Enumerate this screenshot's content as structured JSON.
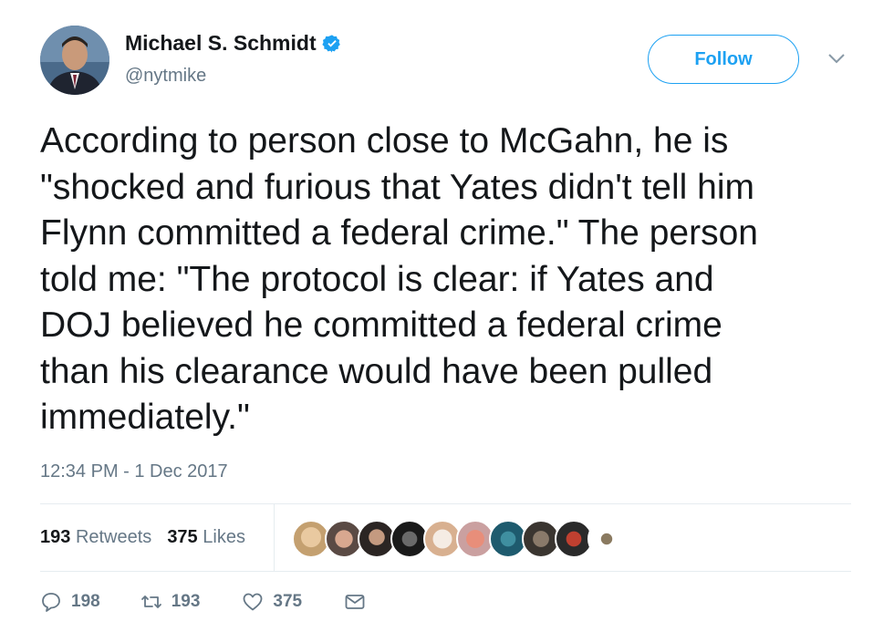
{
  "author": {
    "display_name": "Michael S. Schmidt",
    "handle": "@nytmike"
  },
  "follow_label": "Follow",
  "tweet": {
    "text": "According to person close to McGahn, he is\n\"shocked and furious that Yates didn't tell him\nFlynn committed a federal crime.\" The person\ntold me: \"The protocol is clear: if Yates and\nDOJ believed he committed a federal crime\nthan his clearance would have been pulled\nimmediately.\"",
    "timestamp": "12:34 PM - 1 Dec 2017"
  },
  "stats": {
    "retweets_count": "193",
    "retweets_label": "Retweets",
    "likes_count": "375",
    "likes_label": "Likes"
  },
  "actions": {
    "reply_count": "198",
    "retweet_count": "193",
    "like_count": "375"
  },
  "colors": {
    "accent": "#1da1f2",
    "muted": "#657786",
    "text": "#14171a",
    "divider": "#e6ecf0"
  }
}
